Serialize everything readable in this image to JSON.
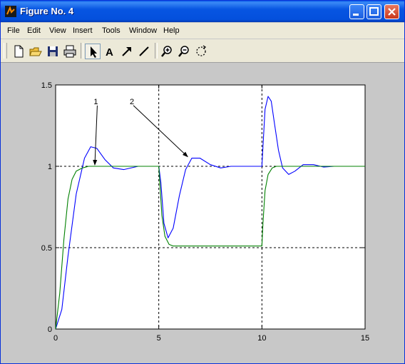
{
  "window": {
    "title": "Figure No. 4"
  },
  "menu": [
    "File",
    "Edit",
    "View",
    "Insert",
    "Tools",
    "Window",
    "Help"
  ],
  "toolbar": [
    "new-file-icon",
    "open-folder-icon",
    "save-icon",
    "print-icon",
    "select-arrow-icon",
    "insert-text-icon",
    "insert-arrow-icon",
    "insert-line-icon",
    "zoom-in-icon",
    "zoom-out-icon",
    "rotate-3d-icon"
  ],
  "chart_data": {
    "type": "line",
    "xlim": [
      0,
      15
    ],
    "ylim": [
      0,
      1.5
    ],
    "xticks": [
      "0",
      "5",
      "10",
      "15"
    ],
    "yticks": [
      "0",
      "0.5",
      "1",
      "1.5"
    ],
    "grid": "dotted lines at x=5, x=10, y=0.5, y=1",
    "series": [
      {
        "color": "#0000ff",
        "x": [
          0,
          0.3,
          0.6,
          1.0,
          1.4,
          1.7,
          2.0,
          2.4,
          2.8,
          3.3,
          4.0,
          5.0,
          5.1,
          5.25,
          5.45,
          5.7,
          6.0,
          6.3,
          6.6,
          7.0,
          7.5,
          8.0,
          8.5,
          9.0,
          10.0,
          10.05,
          10.15,
          10.3,
          10.45,
          10.6,
          10.8,
          11.0,
          11.3,
          11.6,
          12.0,
          12.5,
          13.0,
          13.5,
          15.0
        ],
        "y": [
          0,
          0.12,
          0.45,
          0.83,
          1.05,
          1.12,
          1.11,
          1.04,
          0.99,
          0.98,
          1.0,
          1.0,
          0.9,
          0.65,
          0.56,
          0.62,
          0.82,
          0.98,
          1.05,
          1.05,
          1.01,
          0.99,
          1.0,
          1.0,
          1.0,
          1.12,
          1.35,
          1.43,
          1.4,
          1.27,
          1.1,
          0.99,
          0.95,
          0.97,
          1.01,
          1.01,
          0.995,
          1.0,
          1.0
        ]
      },
      {
        "color": "#008000",
        "x": [
          0,
          0.2,
          0.4,
          0.6,
          0.8,
          1.0,
          1.3,
          1.6,
          2.0,
          5.0,
          5.05,
          5.15,
          5.3,
          5.5,
          5.7,
          6.0,
          10.0,
          10.05,
          10.15,
          10.3,
          10.5,
          10.7,
          11.0,
          15.0
        ],
        "y": [
          0,
          0.22,
          0.55,
          0.8,
          0.92,
          0.97,
          0.99,
          1.0,
          1.0,
          1.0,
          0.9,
          0.7,
          0.57,
          0.52,
          0.51,
          0.51,
          0.51,
          0.65,
          0.85,
          0.95,
          0.99,
          1.0,
          1.0,
          1.0
        ]
      }
    ],
    "annotations": [
      {
        "text": "1",
        "x": 1.95,
        "y": 1.4,
        "ax": 1.9,
        "ay": 1.0
      },
      {
        "text": "2",
        "x": 3.7,
        "y": 1.4,
        "ax": 6.4,
        "ay": 1.05
      }
    ]
  }
}
